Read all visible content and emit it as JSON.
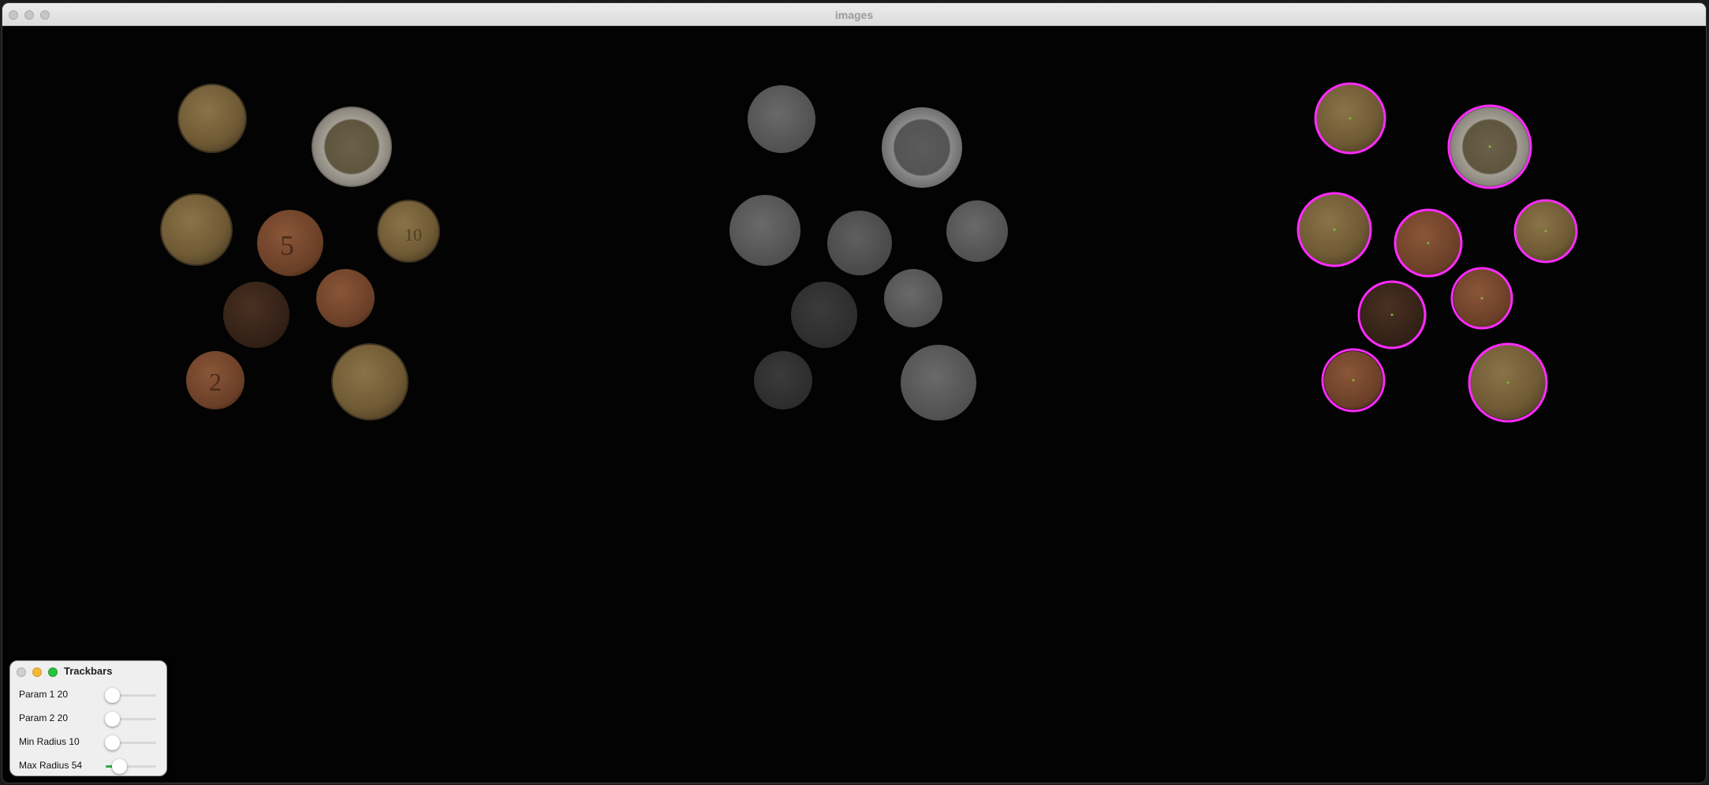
{
  "window": {
    "title": "images"
  },
  "colors": {
    "detection_circle": "#ff2bff"
  },
  "panels": [
    "original-color",
    "grayscale-blur",
    "hough-circles"
  ],
  "trackbars_window": {
    "title": "Trackbars",
    "sliders": [
      {
        "label": "Param 1 20",
        "fraction": 0.12
      },
      {
        "label": "Param 2 20",
        "fraction": 0.12
      },
      {
        "label": "Min Radius 10",
        "fraction": 0.13
      },
      {
        "label": "Max Radius 54",
        "fraction": 0.27
      }
    ]
  }
}
